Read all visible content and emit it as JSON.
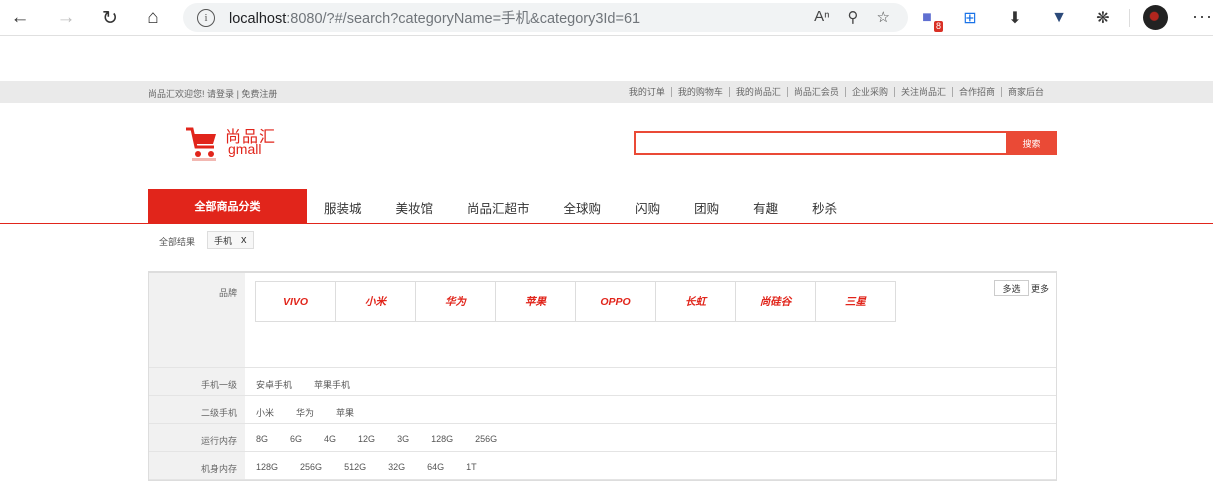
{
  "browser": {
    "url_host": "localhost",
    "url_rest": ":8080/?#/search?categoryName=手机&category3Id=61",
    "ext_badge": "8"
  },
  "topbar": {
    "welcome": "尚品汇欢迎您!",
    "login": "请登录",
    "sep": "|",
    "register": "免费注册",
    "links": [
      "我的订单",
      "我的购物车",
      "我的尚品汇",
      "尚品汇会员",
      "企业采购",
      "关注尚品汇",
      "合作招商",
      "商家后台"
    ]
  },
  "header": {
    "logo_cn": "尚品汇",
    "logo_en": "gmall",
    "search_value": "",
    "search_btn": "搜索"
  },
  "nav": {
    "all_categories": "全部商品分类",
    "links": [
      "服装城",
      "美妆馆",
      "尚品汇超市",
      "全球购",
      "闪购",
      "团购",
      "有趣",
      "秒杀"
    ]
  },
  "breadcrumb": {
    "all": "全部结果",
    "tag": "手机",
    "tag_close": "x"
  },
  "selector": {
    "brand_label": "品牌",
    "brands": [
      "VIVO",
      "小米",
      "华为",
      "苹果",
      "OPPO",
      "长虹",
      "尚硅谷",
      "三星"
    ],
    "multi": "多选",
    "more": "更多",
    "attrs": [
      {
        "label": "手机一级",
        "values": [
          "安卓手机",
          "苹果手机"
        ]
      },
      {
        "label": "二级手机",
        "values": [
          "小米",
          "华为",
          "苹果"
        ]
      },
      {
        "label": "运行内存",
        "values": [
          "8G",
          "6G",
          "4G",
          "12G",
          "3G",
          "128G",
          "256G"
        ]
      },
      {
        "label": "机身内存",
        "values": [
          "128G",
          "256G",
          "512G",
          "32G",
          "64G",
          "1T"
        ]
      }
    ]
  }
}
